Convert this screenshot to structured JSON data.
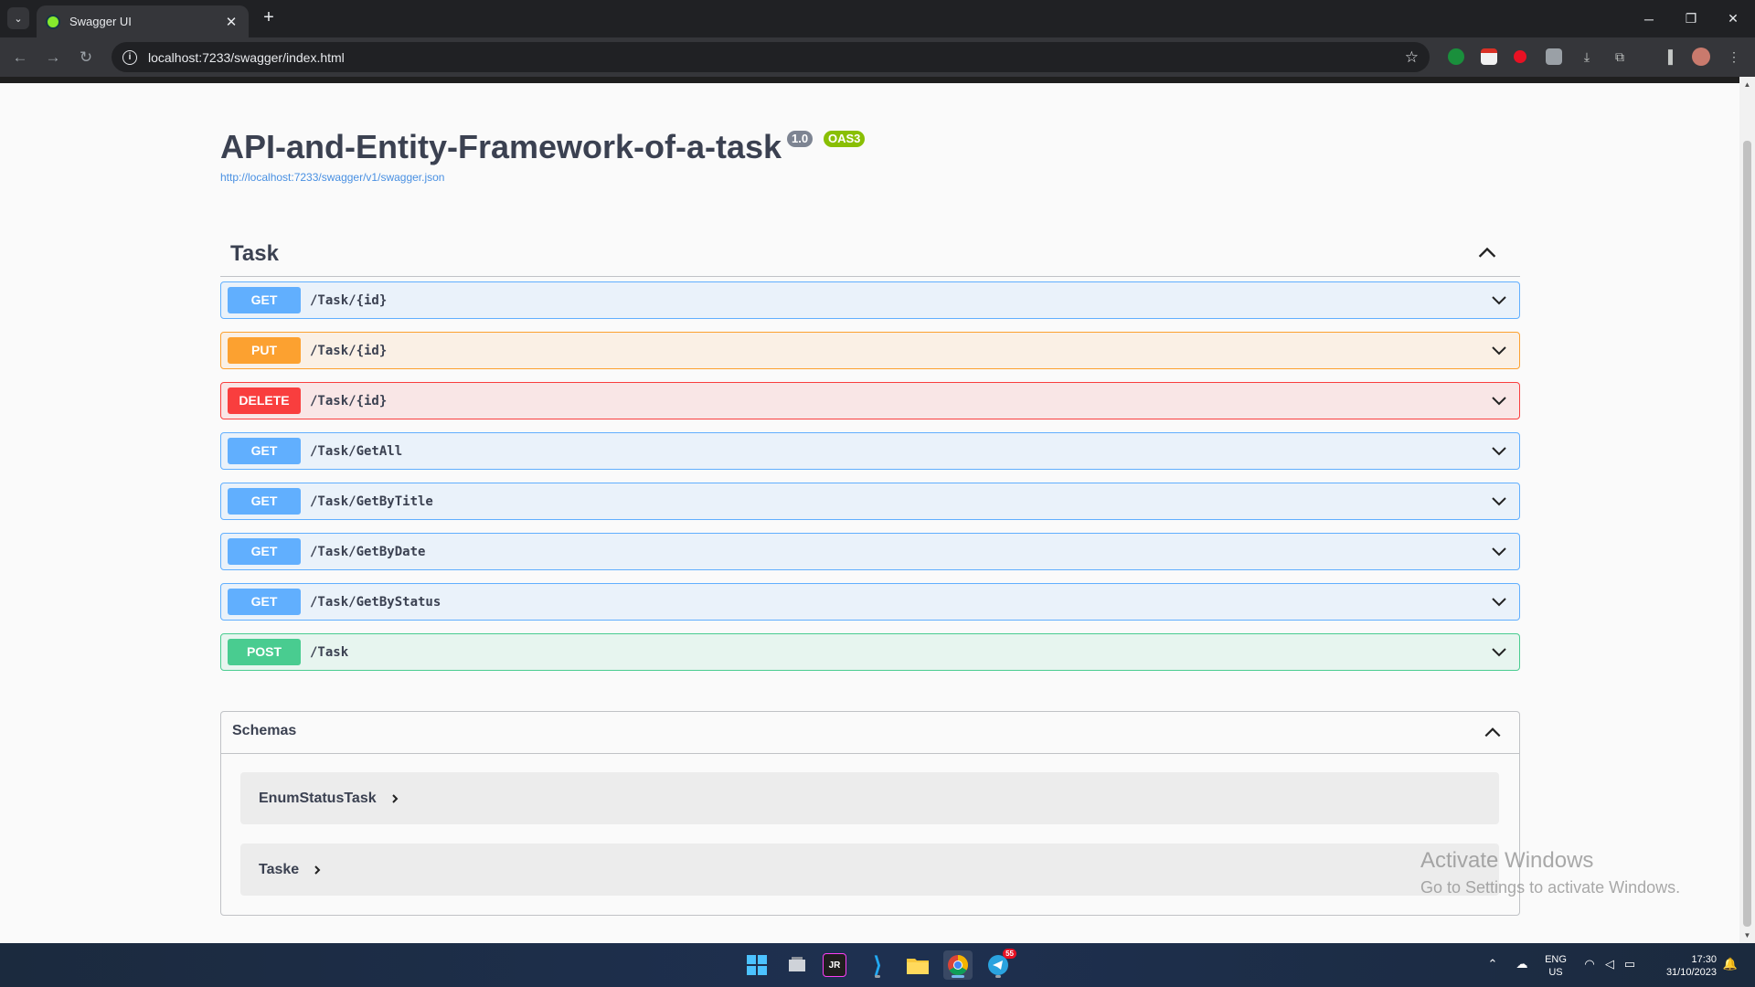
{
  "browser": {
    "tab_title": "Swagger UI",
    "tab_close": "✕",
    "new_tab": "+",
    "url": "localhost:7233/swagger/index.html"
  },
  "swagger": {
    "title": "API-and-Entity-Framework-of-a-task",
    "version": "1.0",
    "oas_badge": "OAS3",
    "spec_url": "http://localhost:7233/swagger/v1/swagger.json",
    "tag_name": "Task",
    "operations": [
      {
        "method": "GET",
        "path": "/Task/{id}",
        "kind": "get"
      },
      {
        "method": "PUT",
        "path": "/Task/{id}",
        "kind": "put"
      },
      {
        "method": "DELETE",
        "path": "/Task/{id}",
        "kind": "delete"
      },
      {
        "method": "GET",
        "path": "/Task/GetAll",
        "kind": "get"
      },
      {
        "method": "GET",
        "path": "/Task/GetByTitle",
        "kind": "get"
      },
      {
        "method": "GET",
        "path": "/Task/GetByDate",
        "kind": "get"
      },
      {
        "method": "GET",
        "path": "/Task/GetByStatus",
        "kind": "get"
      },
      {
        "method": "POST",
        "path": "/Task",
        "kind": "post"
      }
    ],
    "schemas_label": "Schemas",
    "models": [
      "EnumStatusTask",
      "Taske"
    ]
  },
  "watermark": {
    "title": "Activate Windows",
    "subtitle": "Go to Settings to activate Windows."
  },
  "taskbar": {
    "lang_top": "ENG",
    "lang_bottom": "US",
    "time": "17:30",
    "date": "31/10/2023",
    "telegram_badge": "55"
  },
  "colors": {
    "get": "#61affe",
    "put": "#fca130",
    "delete": "#f93e3e",
    "post": "#49cc90",
    "text": "#3b4151"
  }
}
